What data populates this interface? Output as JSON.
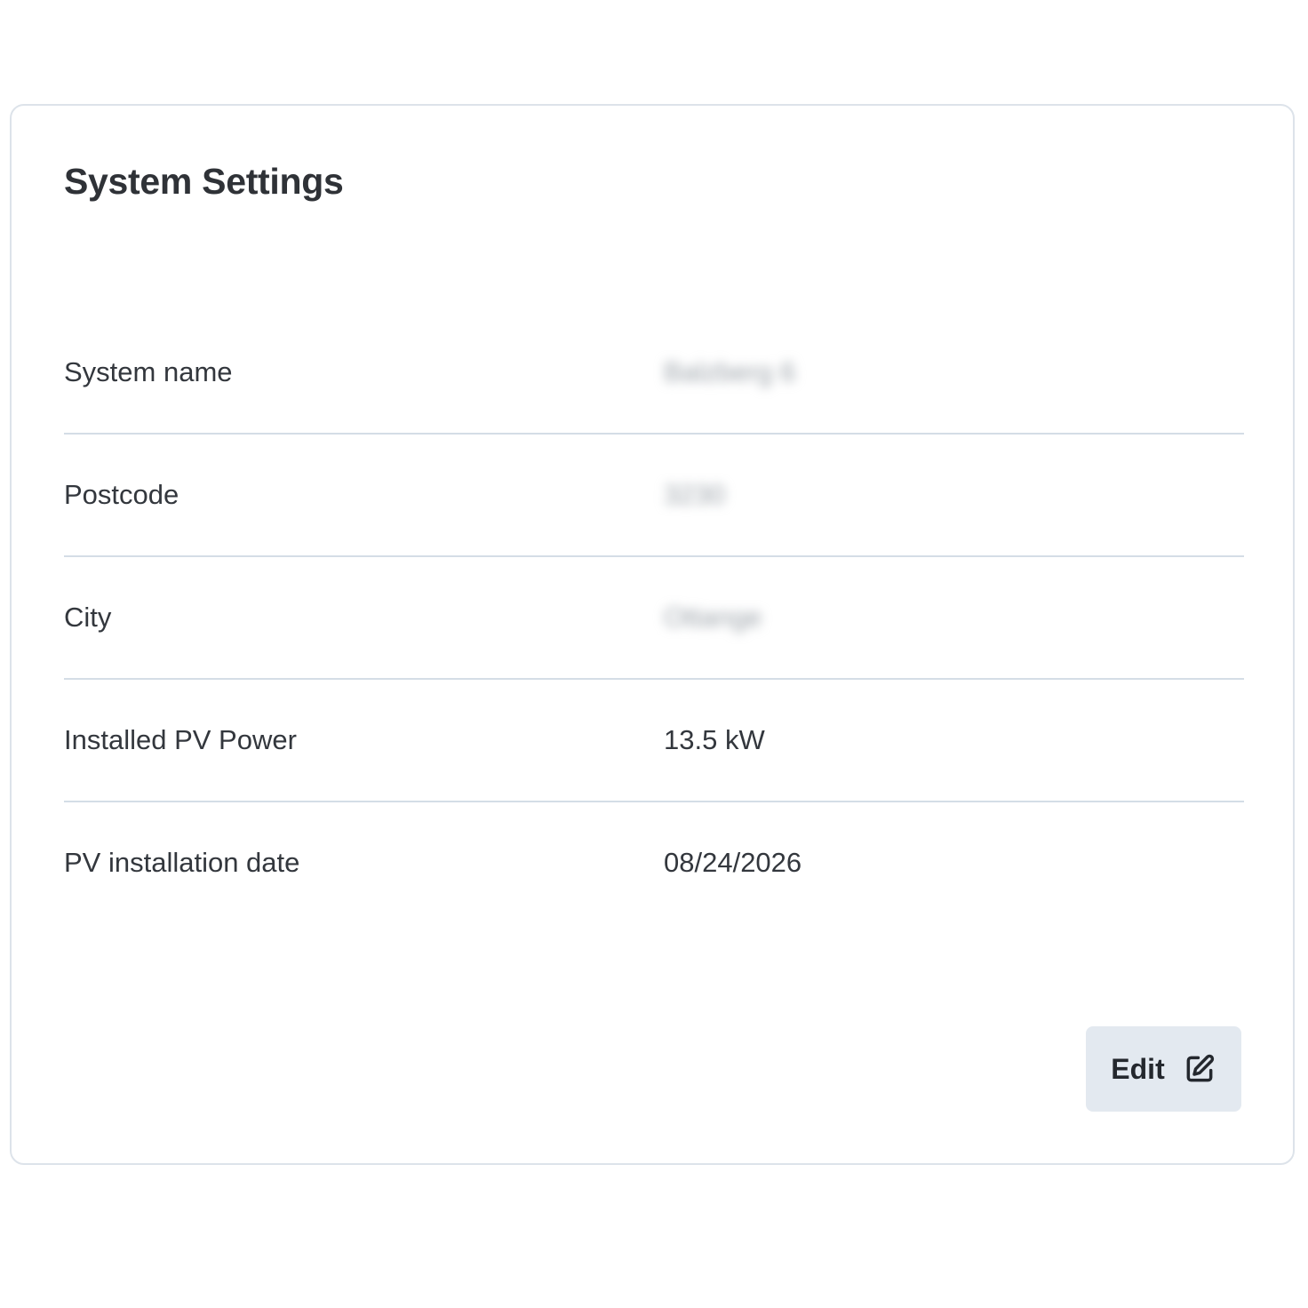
{
  "card": {
    "title": "System Settings"
  },
  "rows": [
    {
      "label": "System name",
      "value": "Balzberg 6",
      "redacted": true
    },
    {
      "label": "Postcode",
      "value": "3230",
      "redacted": true
    },
    {
      "label": "City",
      "value": "Ottange",
      "redacted": true
    },
    {
      "label": "Installed PV Power",
      "value": "13.5 kW",
      "redacted": false
    },
    {
      "label": "PV installation date",
      "value": "08/24/2026",
      "redacted": false
    }
  ],
  "actions": {
    "edit_label": "Edit",
    "edit_icon": "edit-icon"
  }
}
